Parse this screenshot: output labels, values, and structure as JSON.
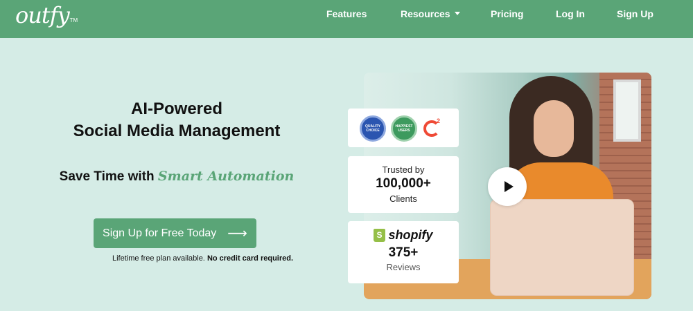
{
  "nav": {
    "logo": "outfy",
    "logo_tm": "TM",
    "items": [
      {
        "label": "Features"
      },
      {
        "label": "Resources"
      },
      {
        "label": "Pricing"
      },
      {
        "label": "Log In"
      },
      {
        "label": "Sign Up"
      }
    ]
  },
  "hero": {
    "title_line1": "AI-Powered",
    "title_line2": "Social Media Management",
    "subtitle_prefix": "Save Time with",
    "subtitle_accent": "Smart Automation",
    "cta_label": "Sign Up for Free Today",
    "cta_arrow": "⟶",
    "fine_print": "Lifetime free plan available.",
    "fine_print_bold": "No credit card required."
  },
  "badges": {
    "quality_line1": "QUALITY",
    "quality_line2": "CHOICE",
    "happy_line1": "HAPPIEST",
    "happy_line2": "USERS",
    "g2_label": "2"
  },
  "trust_card": {
    "top": "Trusted by",
    "number": "100,000+",
    "bottom": "Clients"
  },
  "shopify_card": {
    "brand": "shopify",
    "number": "375+",
    "label": "Reviews"
  },
  "colors": {
    "brand_green": "#5aa577",
    "hero_background": "#d5ece6"
  }
}
